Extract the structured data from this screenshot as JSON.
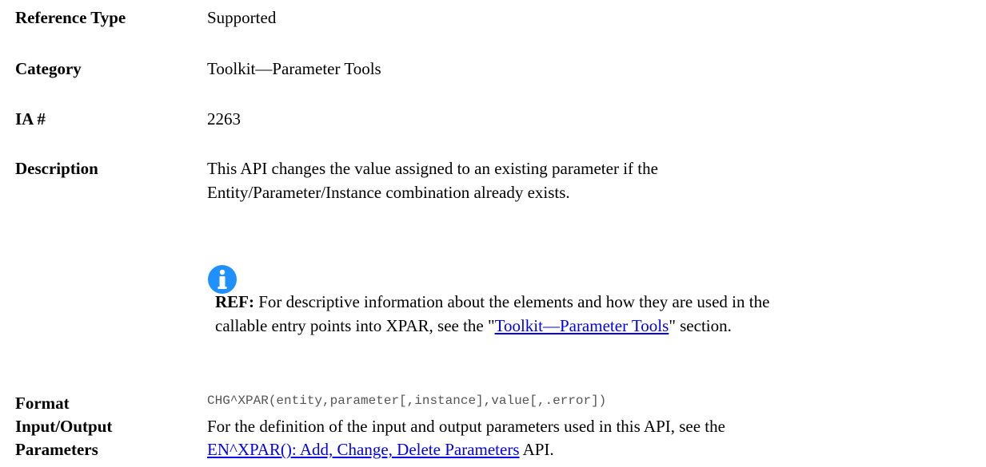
{
  "rows": {
    "reference_type": {
      "label": "Reference Type",
      "value": "Supported"
    },
    "category": {
      "label": "Category",
      "value": "Toolkit—Parameter Tools"
    },
    "ia": {
      "label": "IA #",
      "value": "2263"
    },
    "description": {
      "label": "Description",
      "text": "This API changes the value assigned to an existing parameter if the Entity/Parameter/Instance combination already exists."
    },
    "format": {
      "label": "Format",
      "value": "CHG^XPAR(entity,parameter[,instance],value[,.error])"
    },
    "io": {
      "label_line1": "Input/Output",
      "label_line2": "Parameters",
      "text_before": "For the definition of the input and output parameters used in this API, see the",
      "link": "EN^XPAR(): Add, Change, Delete Parameters",
      "text_after": " API."
    }
  },
  "note": {
    "icon": "info-icon",
    "icon_color": "#1e90ff",
    "ref_label": "REF:",
    "text_before": " For descriptive information about the elements and how they are used in the callable entry points into XPAR, see the \"",
    "link": "Toolkit—Parameter Tools",
    "text_after": "\" section."
  },
  "colors": {
    "link": "#0000ee"
  }
}
